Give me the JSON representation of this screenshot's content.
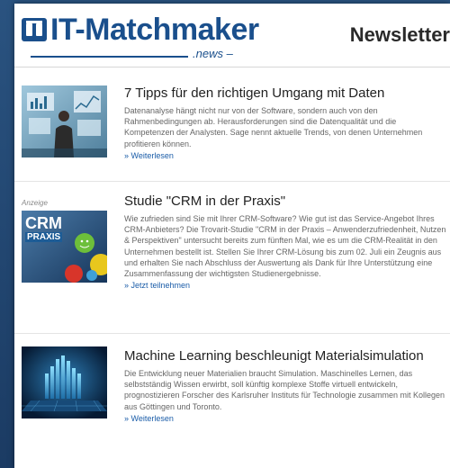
{
  "header": {
    "logo_text": "IT-Matchmaker",
    "logo_sub": ".news –",
    "newsletter_title": "Newsletter"
  },
  "articles": [
    {
      "title": "7 Tipps für den richtigen Umgang mit Daten",
      "text": "Datenanalyse hängt nicht nur von der Software, sondern auch von den Rahmenbedingungen ab. Herausforderungen sind die Datenqualität und die Kompetenzen der Analysten. Sage nennt aktuelle Trends, von denen Unternehmen profitieren können.",
      "link": "» Weiterlesen"
    },
    {
      "ad_label": "Anzeige",
      "title": "Studie \"CRM in der Praxis\"",
      "text": "Wie zufrieden sind Sie mit Ihrer CRM-Software? Wie gut ist das Service-Angebot Ihres CRM-Anbieters? Die Trovarit-Studie \"CRM in der Praxis – Anwenderzufriedenheit, Nutzen & Perspektiven\" untersucht bereits zum fünften Mal, wie es um die CRM-Realität in den Unternehmen bestellt ist. Stellen Sie Ihrer CRM-Lösung bis zum 02. Juli ein Zeugnis aus und erhalten Sie nach Abschluss der Auswertung als Dank für Ihre Unterstützung eine Zusammenfassung der wichtigsten Studienergebnisse.",
      "link": "» Jetzt teilnehmen",
      "thumb_text_1": "CRM",
      "thumb_text_2": "PRAXIS"
    },
    {
      "title": "Machine Learning beschleunigt Materialsimulation",
      "text": "Die Entwicklung neuer Materialien braucht Simulation. Maschinelles Lernen, das selbstständig Wissen erwirbt, soll künftig komplexe Stoffe virtuell entwickeln, prognostizieren Forscher des Karlsruher Instituts für Technologie zusammen mit Kollegen aus Göttingen und Toronto.",
      "link": "» Weiterlesen"
    }
  ]
}
